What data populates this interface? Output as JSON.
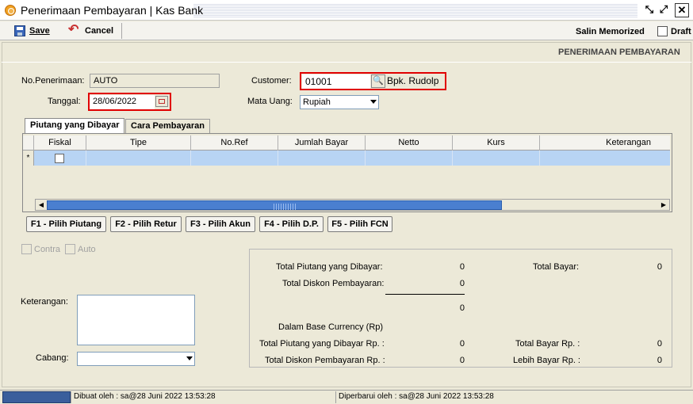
{
  "window": {
    "title": "Penerimaan Pembayaran | Kas Bank",
    "controls": {
      "restore": "↙↗",
      "maximize": "⤢",
      "close": "✕"
    }
  },
  "toolbar": {
    "save_label": "Save",
    "cancel_label": "Cancel",
    "salin_label": "Salin Memorized",
    "draft_label": "Draft",
    "draft_checked": false
  },
  "header": {
    "section_title": "PENERIMAAN PEMBAYARAN"
  },
  "form": {
    "no_penerimaan_label": "No.Penerimaan:",
    "no_penerimaan_value": "AUTO",
    "tanggal_label": "Tanggal:",
    "tanggal_value": "28/06/2022",
    "customer_label": "Customer:",
    "customer_code": "01001",
    "customer_name": "Bpk. Rudolp",
    "mata_uang_label": "Mata Uang:",
    "mata_uang_value": "Rupiah"
  },
  "tabs": [
    {
      "label": "Piutang yang Dibayar",
      "active": true
    },
    {
      "label": "Cara Pembayaran",
      "active": false
    }
  ],
  "grid": {
    "columns": [
      "Fiskal",
      "Tipe",
      "No.Ref",
      "Jumlah Bayar",
      "Netto",
      "Kurs",
      "Keterangan"
    ],
    "row_indicator": "*"
  },
  "function_buttons": [
    "F1 - Pilih Piutang",
    "F2 - Pilih Retur",
    "F3 - Pilih Akun",
    "F4 - Pilih D.P.",
    "F5 - Pilih FCN"
  ],
  "options": {
    "contra_label": "Contra",
    "auto_label": "Auto"
  },
  "bottom": {
    "keterangan_label": "Keterangan:",
    "cabang_label": "Cabang:",
    "cabang_value": ""
  },
  "totals": {
    "total_piutang_label": "Total Piutang yang Dibayar:",
    "total_piutang_value": "0",
    "total_diskon_label": "Total Diskon Pembayaran:",
    "total_diskon_value": "0",
    "subtotal_value": "0",
    "total_bayar_label": "Total Bayar:",
    "total_bayar_value": "0",
    "base_currency_label": "Dalam Base Currency (Rp)",
    "total_piutang_rp_label": "Total Piutang yang Dibayar Rp. :",
    "total_piutang_rp_value": "0",
    "total_diskon_rp_label": "Total Diskon Pembayaran Rp. :",
    "total_diskon_rp_value": "0",
    "total_bayar_rp_label": "Total Bayar Rp. :",
    "total_bayar_rp_value": "0",
    "lebih_bayar_rp_label": "Lebih Bayar Rp. :",
    "lebih_bayar_rp_value": "0"
  },
  "status": {
    "dibuat": "Dibuat oleh : sa@28 Juni 2022  13:53:28",
    "diperbarui": "Diperbarui oleh : sa@28 Juni 2022  13:53:28"
  },
  "colors": {
    "highlight_row": "#b8d4f4",
    "required_border": "#e00000",
    "scroll_thumb": "#4a7fd0",
    "status_blue": "#3a5e9c"
  }
}
